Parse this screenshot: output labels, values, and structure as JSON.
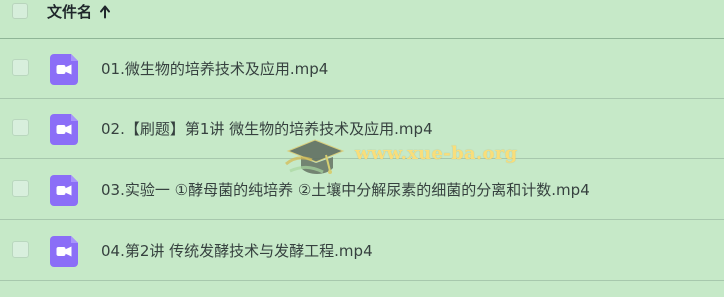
{
  "header": {
    "title": "文件名"
  },
  "files": [
    {
      "name": "01.微生物的培养技术及应用.mp4"
    },
    {
      "name": "02.【刷题】第1讲 微生物的培养技术及应用.mp4"
    },
    {
      "name": "03.实验一 ①酵母菌的纯培养 ②土壤中分解尿素的细菌的分离和计数.mp4"
    },
    {
      "name": "04.第2讲 传统发酵技术与发酵工程.mp4"
    }
  ],
  "watermark": {
    "text": "www.xue-ba.org"
  },
  "icons": {
    "sort": "arrow-up-icon",
    "file": "video-file-icon",
    "watermark": "mortarboard-icon"
  },
  "colors": {
    "background": "#c6e9c8",
    "video_icon": "#8b6ef7",
    "header_border": "#8fb597"
  }
}
